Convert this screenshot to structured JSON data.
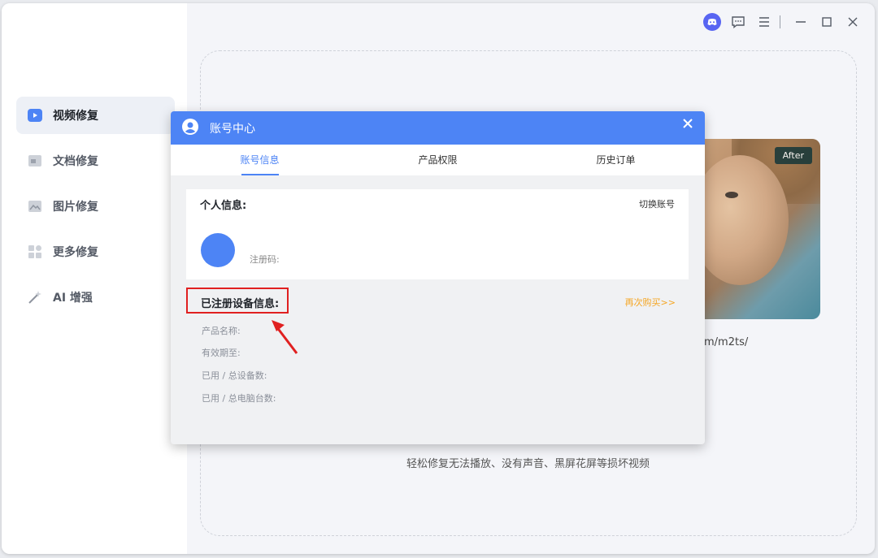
{
  "sidebar": {
    "items": [
      {
        "label": "视频修复",
        "icon": "video-repair-icon",
        "active": true
      },
      {
        "label": "文档修复",
        "icon": "document-repair-icon",
        "active": false
      },
      {
        "label": "图片修复",
        "icon": "image-repair-icon",
        "active": false
      },
      {
        "label": "更多修复",
        "icon": "more-repair-icon",
        "active": false
      },
      {
        "label": "AI 增强",
        "icon": "ai-enhance-icon",
        "active": false
      }
    ]
  },
  "topbar": {
    "icons": [
      "discord-icon",
      "feedback-icon",
      "menu-icon",
      "minimize-icon",
      "maximize-icon",
      "close-icon"
    ]
  },
  "main": {
    "after_badge": "After",
    "url_fragment": "m/m2ts/",
    "hint": "轻松修复无法播放、没有声音、黑屏花屏等损坏视频"
  },
  "dialog": {
    "title": "账号中心",
    "tabs": [
      {
        "label": "账号信息",
        "active": true
      },
      {
        "label": "产品权限",
        "active": false
      },
      {
        "label": "历史订单",
        "active": false
      }
    ],
    "personal": {
      "title": "个人信息:",
      "switch_account": "切换账号",
      "reg_code_label": "注册码:"
    },
    "device": {
      "title": "已注册设备信息:",
      "rebuy": "再次购买>>",
      "rows": [
        "产品名称:",
        "有效期至:",
        "已用 / 总设备数:",
        "已用 / 总电脑台数:"
      ]
    }
  },
  "colors": {
    "accent": "#4d84f5",
    "highlight_border": "#e02020",
    "rebuy": "#f5a623"
  }
}
